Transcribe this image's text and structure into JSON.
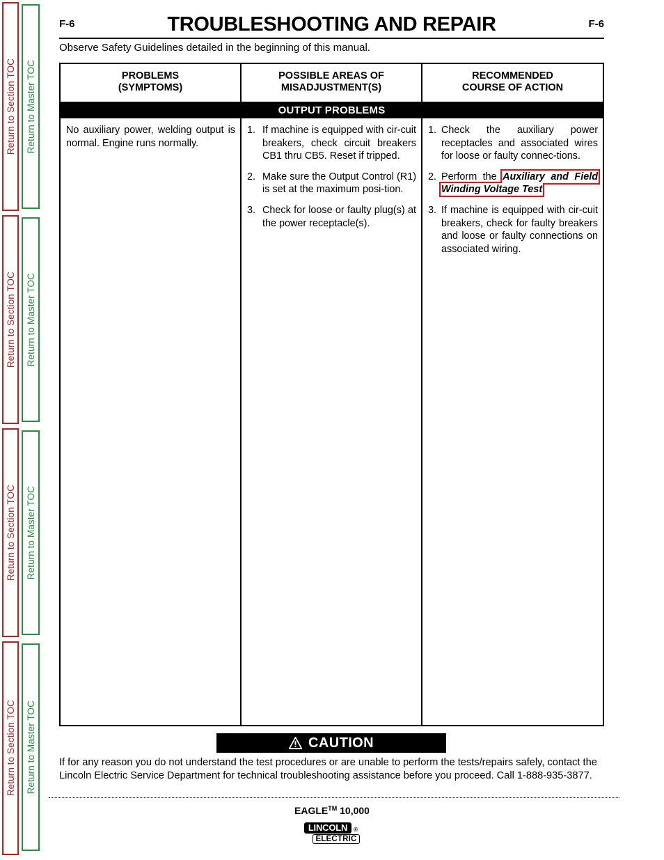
{
  "sidebar": {
    "section_toc_label": "Return to Section TOC",
    "master_toc_label": "Return to Master TOC",
    "section_color": "#b62222",
    "master_color": "#2e8b44",
    "repeat_count": 4
  },
  "header": {
    "page_number_left": "F-6",
    "page_number_right": "F-6",
    "title": "TROUBLESHOOTING AND REPAIR",
    "subtitle": "Observe Safety Guidelines detailed in the beginning of this manual."
  },
  "table": {
    "columns": [
      {
        "line1": "PROBLEMS",
        "line2": "(SYMPTOMS)"
      },
      {
        "line1": "POSSIBLE AREAS OF",
        "line2": "MISADJUSTMENT(S)"
      },
      {
        "line1": "RECOMMENDED",
        "line2": "COURSE OF ACTION"
      }
    ],
    "section_band": "OUTPUT PROBLEMS",
    "row": {
      "problem": "No auxiliary power, welding output is normal.  Engine runs normally.",
      "misadjustments": [
        {
          "num": "1.",
          "text": "If machine is equipped with cir-cuit breakers, check circuit breakers CB1 thru CB5.  Reset if tripped."
        },
        {
          "num": "2.",
          "text": "Make sure the Output Control (R1) is set at the maximum posi-tion."
        },
        {
          "num": "3.",
          "text": "Check for loose or faulty plug(s) at the power receptacle(s)."
        }
      ],
      "actions": [
        {
          "num": "1.",
          "text": "Check the auxiliary power receptacles and associated wires for loose or faulty connec-tions."
        },
        {
          "num": "2.",
          "prefix": "Perform the ",
          "link": "Auxiliary and Field Winding Voltage Test",
          "suffix": ".",
          "link_box_color": "#ee1111"
        },
        {
          "num": "3.",
          "text": "If machine is equipped with cir-cuit breakers, check for faulty breakers and loose or faulty connections on associated wiring."
        }
      ]
    }
  },
  "caution": {
    "label": "CAUTION",
    "icon": "warning-triangle-icon",
    "body": "If for any reason you do not understand the test procedures or are unable to perform the tests/repairs safely, contact the Lincoln Electric Service Department for technical troubleshooting assistance before you proceed. Call 1-888-935-3877."
  },
  "footer": {
    "model_name": "EAGLE",
    "model_tm": "TM",
    "model_number": " 10,000",
    "logo_line1": "LINCOLN",
    "logo_line2": "ELECTRIC",
    "logo_registered": "®"
  }
}
